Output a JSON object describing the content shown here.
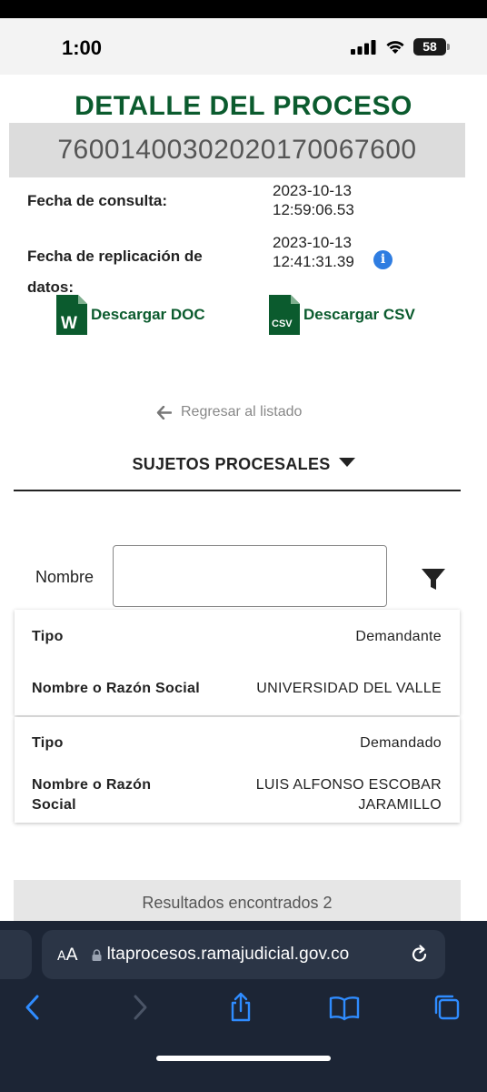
{
  "status_bar": {
    "time": "1:00",
    "battery": "58"
  },
  "page": {
    "title": "DETALLE DEL PROCESO",
    "process_number": "76001400302020170067600",
    "consulta_label": "Fecha de consulta:",
    "consulta_date": "2023-10-13",
    "consulta_time": "12:59:06.53",
    "replicacion_label_1": "Fecha de replicación de",
    "replicacion_label_2": "datos:",
    "replicacion_date": "2023-10-13",
    "replicacion_time": "12:41:31.39",
    "info_glyph": "i",
    "download_doc": "Descargar DOC",
    "download_csv": "Descargar CSV",
    "doc_icon_letter": "W",
    "csv_icon_text": "CSV",
    "back_label": "Regresar al listado",
    "section_title": "SUJETOS PROCESALES"
  },
  "filter": {
    "label": "Nombre",
    "value": "",
    "placeholder": ""
  },
  "subjects": [
    {
      "tipo_label": "Tipo",
      "tipo": "Demandante",
      "nombre_label": "Nombre o Razón Social",
      "nombre": "UNIVERSIDAD DEL VALLE"
    },
    {
      "tipo_label": "Tipo",
      "tipo": "Demandado",
      "nombre_label_1": "Nombre o Razón",
      "nombre_label_2": "Social",
      "nombre_1": "LUIS ALFONSO ESCOBAR",
      "nombre_2": "JARAMILLO"
    }
  ],
  "results": "Resultados encontrados 2",
  "browser": {
    "aa_small": "A",
    "aa_big": "A",
    "url": "ltaprocesos.ramajudicial.gov.co"
  },
  "icons": [
    "signal-icon",
    "wifi-icon",
    "battery-icon",
    "word-file-icon",
    "csv-file-icon",
    "info-icon",
    "back-arrow-icon",
    "caret-down-icon",
    "filter-icon",
    "lock-icon",
    "reload-icon",
    "back-icon",
    "forward-icon",
    "share-icon",
    "bookmarks-icon",
    "tabs-icon"
  ],
  "colors": {
    "brand_green": "#0b5b2e",
    "info_blue": "#2f7de1",
    "safari_bg": "#1c2535",
    "link_blue": "#2f8cff"
  }
}
